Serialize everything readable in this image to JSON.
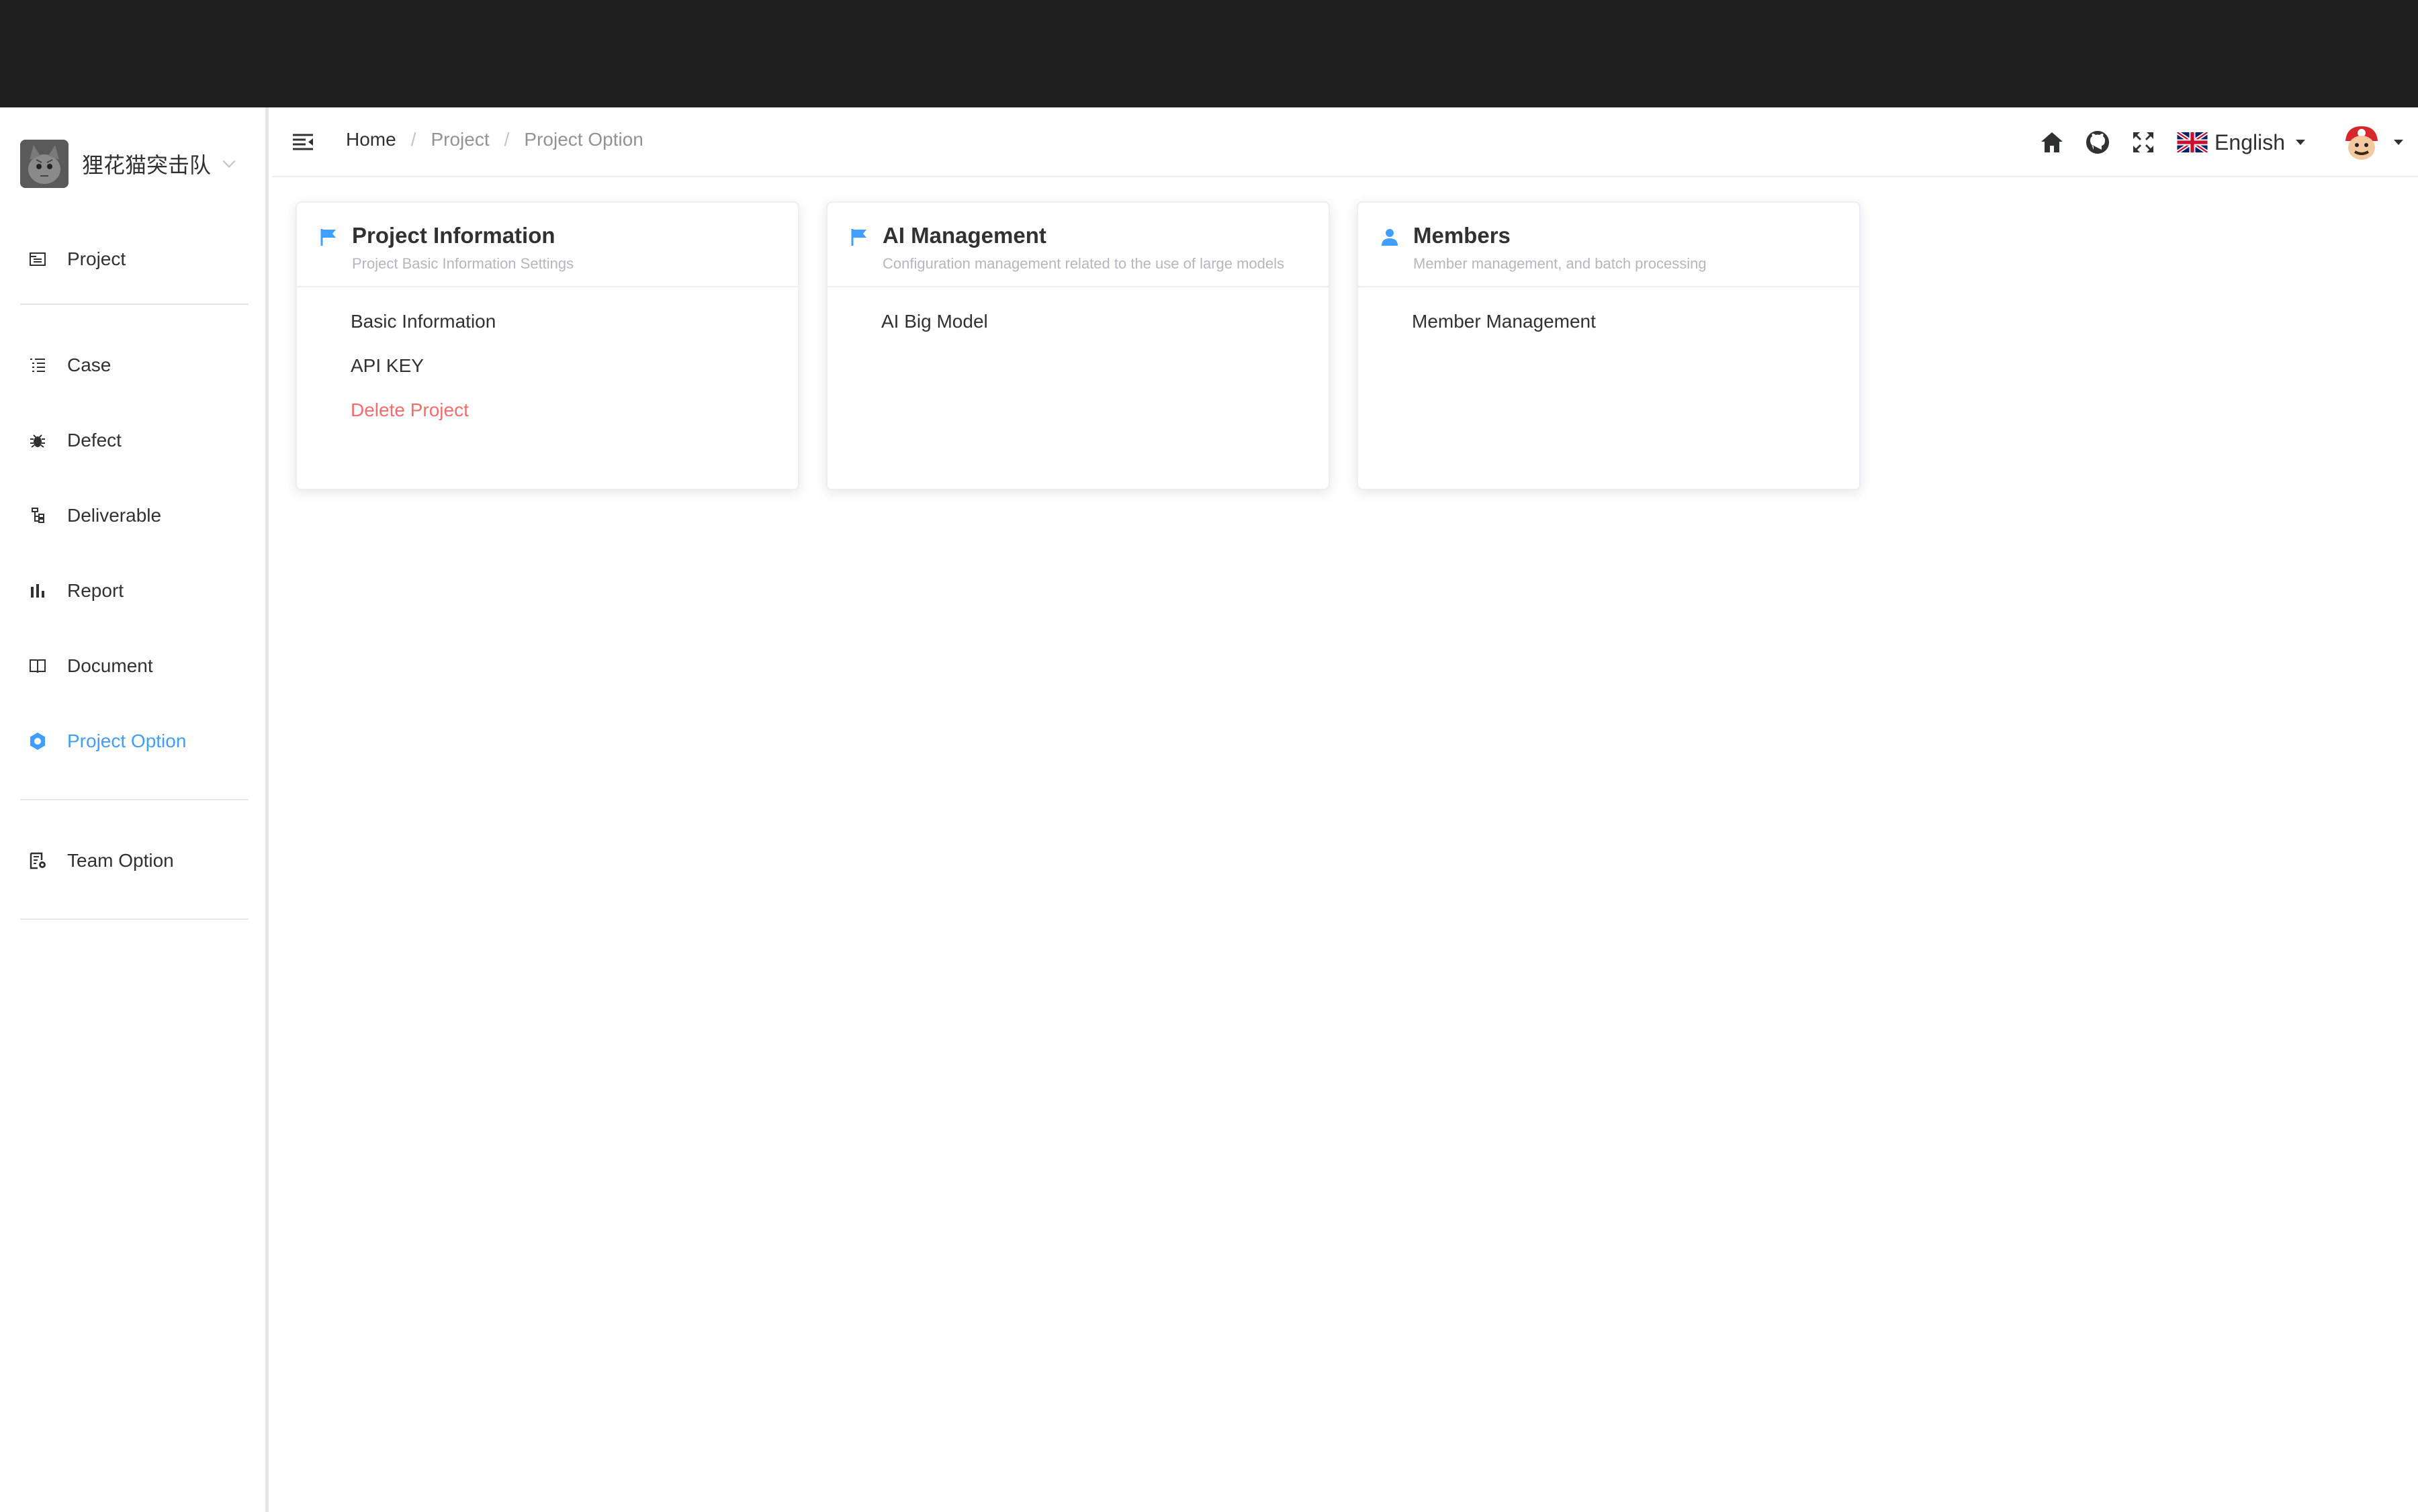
{
  "team": {
    "name": "狸花猫突击队"
  },
  "sidebar": {
    "items": [
      {
        "label": "Project",
        "icon": "project-icon"
      },
      {
        "label": "Case",
        "icon": "list-icon"
      },
      {
        "label": "Defect",
        "icon": "bug-icon"
      },
      {
        "label": "Deliverable",
        "icon": "tree-icon"
      },
      {
        "label": "Report",
        "icon": "bar-chart-icon"
      },
      {
        "label": "Document",
        "icon": "book-icon"
      },
      {
        "label": "Project Option",
        "icon": "gear-icon",
        "active": true
      },
      {
        "label": "Team Option",
        "icon": "team-settings-icon"
      }
    ]
  },
  "breadcrumb": {
    "home": "Home",
    "project": "Project",
    "current": "Project Option"
  },
  "header": {
    "language": "English"
  },
  "cards": [
    {
      "title": "Project Information",
      "subtitle": "Project Basic Information Settings",
      "icon": "flag-icon",
      "links": [
        "Basic Information",
        "API KEY"
      ],
      "danger_link": "Delete Project"
    },
    {
      "title": "AI Management",
      "subtitle": "Configuration management related to the use of large models",
      "icon": "flag-icon",
      "links": [
        "AI Big Model"
      ]
    },
    {
      "title": "Members",
      "subtitle": "Member management, and batch processing",
      "icon": "user-icon",
      "links": [
        "Member Management"
      ]
    }
  ],
  "colors": {
    "accent": "#409eff",
    "danger": "#f56c6c",
    "topbar": "#1e1e1e"
  }
}
